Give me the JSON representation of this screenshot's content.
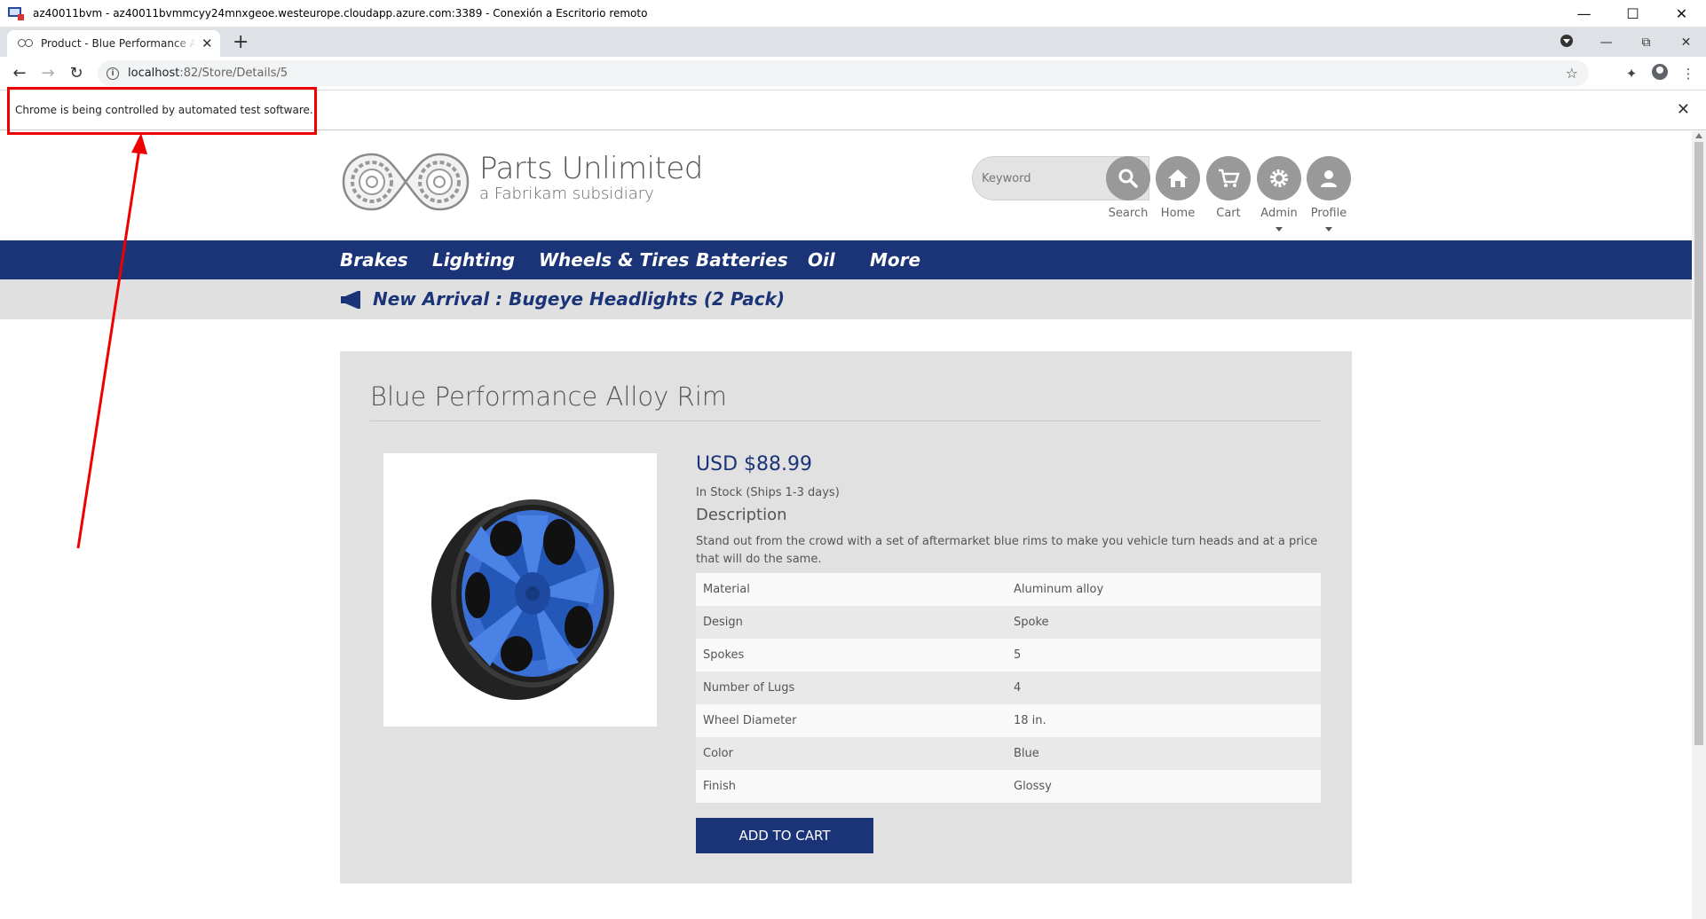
{
  "rdp": {
    "title": "az40011bvm - az40011bvmmcyy24mnxgeoe.westeurope.cloudapp.azure.com:3389 - Conexión a Escritorio remoto"
  },
  "browser": {
    "tab_title": "Product - Blue Performance Alloy Rim",
    "url_host": "localhost",
    "url_rest": ":82/Store/Details/5",
    "infobar_text": "Chrome is being controlled by automated test software."
  },
  "site": {
    "brand_name": "Parts Unlimited",
    "brand_sub": "a Fabrikam subsidiary",
    "search_placeholder": "Keyword",
    "header_buttons": [
      "Search",
      "Home",
      "Cart",
      "Admin",
      "Profile"
    ],
    "nav": [
      "Brakes",
      "Lighting",
      "Wheels & Tires",
      "Batteries",
      "Oil",
      "More"
    ],
    "announcement": "New Arrival : Bugeye Headlights (2 Pack)"
  },
  "product": {
    "title": "Blue Performance Alloy Rim",
    "price": "USD $88.99",
    "stock": "In Stock (Ships 1-3 days)",
    "description_heading": "Description",
    "description": "Stand out from the crowd with a set of aftermarket blue rims to make you vehicle turn heads and at a price that will do the same.",
    "specs": [
      {
        "key": "Material",
        "value": "Aluminum alloy"
      },
      {
        "key": "Design",
        "value": "Spoke"
      },
      {
        "key": "Spokes",
        "value": "5"
      },
      {
        "key": "Number of Lugs",
        "value": "4"
      },
      {
        "key": "Wheel Diameter",
        "value": "18 in."
      },
      {
        "key": "Color",
        "value": "Blue"
      },
      {
        "key": "Finish",
        "value": "Glossy"
      }
    ],
    "add_to_cart": "ADD TO CART"
  },
  "colors": {
    "brand_blue": "#1b3478",
    "annotation_red": "#e00000"
  }
}
